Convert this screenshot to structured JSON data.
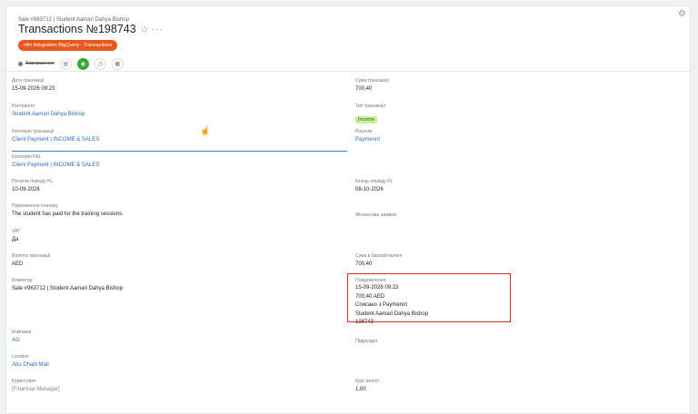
{
  "header": {
    "breadcrumb": "Sale #963712 | Student Aamari Dahya Bishop",
    "title": "Transactions №198743",
    "star_icon": "☆",
    "more_icon": "···",
    "settings_icon": "⚙",
    "chip": "n8n Integration BigQuery - Transactions"
  },
  "toolbar": {
    "status": "Завершення",
    "icons": [
      "doc-icon",
      "ok-icon",
      "clock-icon",
      "grid-icon"
    ]
  },
  "left": {
    "date": {
      "label": "Дата транзакції",
      "value": "15-09-2026 09:23"
    },
    "contractor": {
      "label": "Контрагент",
      "value": "Student Aamari Dahya Bishop"
    },
    "category": {
      "label": "Категорія транзакції",
      "value": "Client Payment | INCOME & SALES"
    },
    "pl_category": {
      "label": "Категорія P&L",
      "value": "Client Payment | INCOME & SALES"
    },
    "pl_start": {
      "label": "Початок періоду PL",
      "value": "10-09-2026"
    },
    "purpose": {
      "label": "Призначення платежу",
      "value": "The student has paid for the training sessions."
    },
    "vat": {
      "label": "VAT",
      "value": "Да"
    },
    "currency": {
      "label": "Валюта транзакції",
      "value": "AED"
    },
    "comment": {
      "label": "Коментар",
      "value": "Sale #963712 | Student Aamari Dahya Bishop"
    },
    "company": {
      "label": "Компанія",
      "value": "AG"
    },
    "location": {
      "label": "Location",
      "value": "Abu Dhabi Mall"
    },
    "user": {
      "label": "Користувач",
      "value": "[Financial Manager]"
    }
  },
  "right": {
    "amount": {
      "label": "Сума транзакції",
      "value": "700,40"
    },
    "type": {
      "label": "Тип транзакції",
      "value": "Income"
    },
    "account": {
      "label": "Рахунок",
      "value": "Paymennt"
    },
    "pl_end": {
      "label": "Кінець періоду PL",
      "value": "08-10-2026"
    },
    "fin_request": {
      "label": "Фінансова заявка"
    },
    "base_amount": {
      "label": "Сума в базовій валюті",
      "value": "700,40"
    },
    "notification": {
      "label": "Повідомлення",
      "lines": [
        "15-09-2026 09:23",
        "700,40 AED",
        "Списано з Paymennt",
        "Student Aamari Dahya Bishop",
        "198743"
      ]
    },
    "division": {
      "label": "Підрозділ"
    },
    "fx_rate": {
      "label": "Курс валют",
      "value": "1,00"
    }
  }
}
